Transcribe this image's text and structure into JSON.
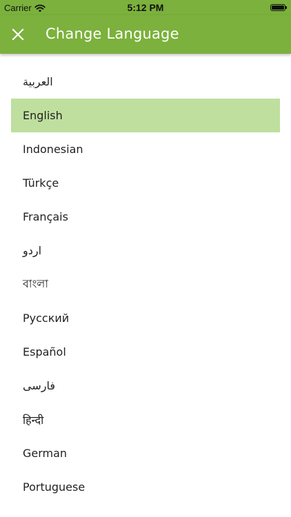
{
  "status_bar": {
    "carrier": "Carrier",
    "time": "5:12 PM"
  },
  "header": {
    "title": "Change Language",
    "close_icon": "close-icon"
  },
  "colors": {
    "primary": "#7bb13c",
    "selected": "#bfdf9f"
  },
  "languages": [
    "العربية",
    "English",
    "Indonesian",
    "Türkçe",
    "Français",
    "اردو",
    "বাংলা",
    "Русский",
    "Español",
    "فارسی",
    "हिन्दी",
    "German",
    "Portuguese"
  ],
  "selected_language": "English"
}
